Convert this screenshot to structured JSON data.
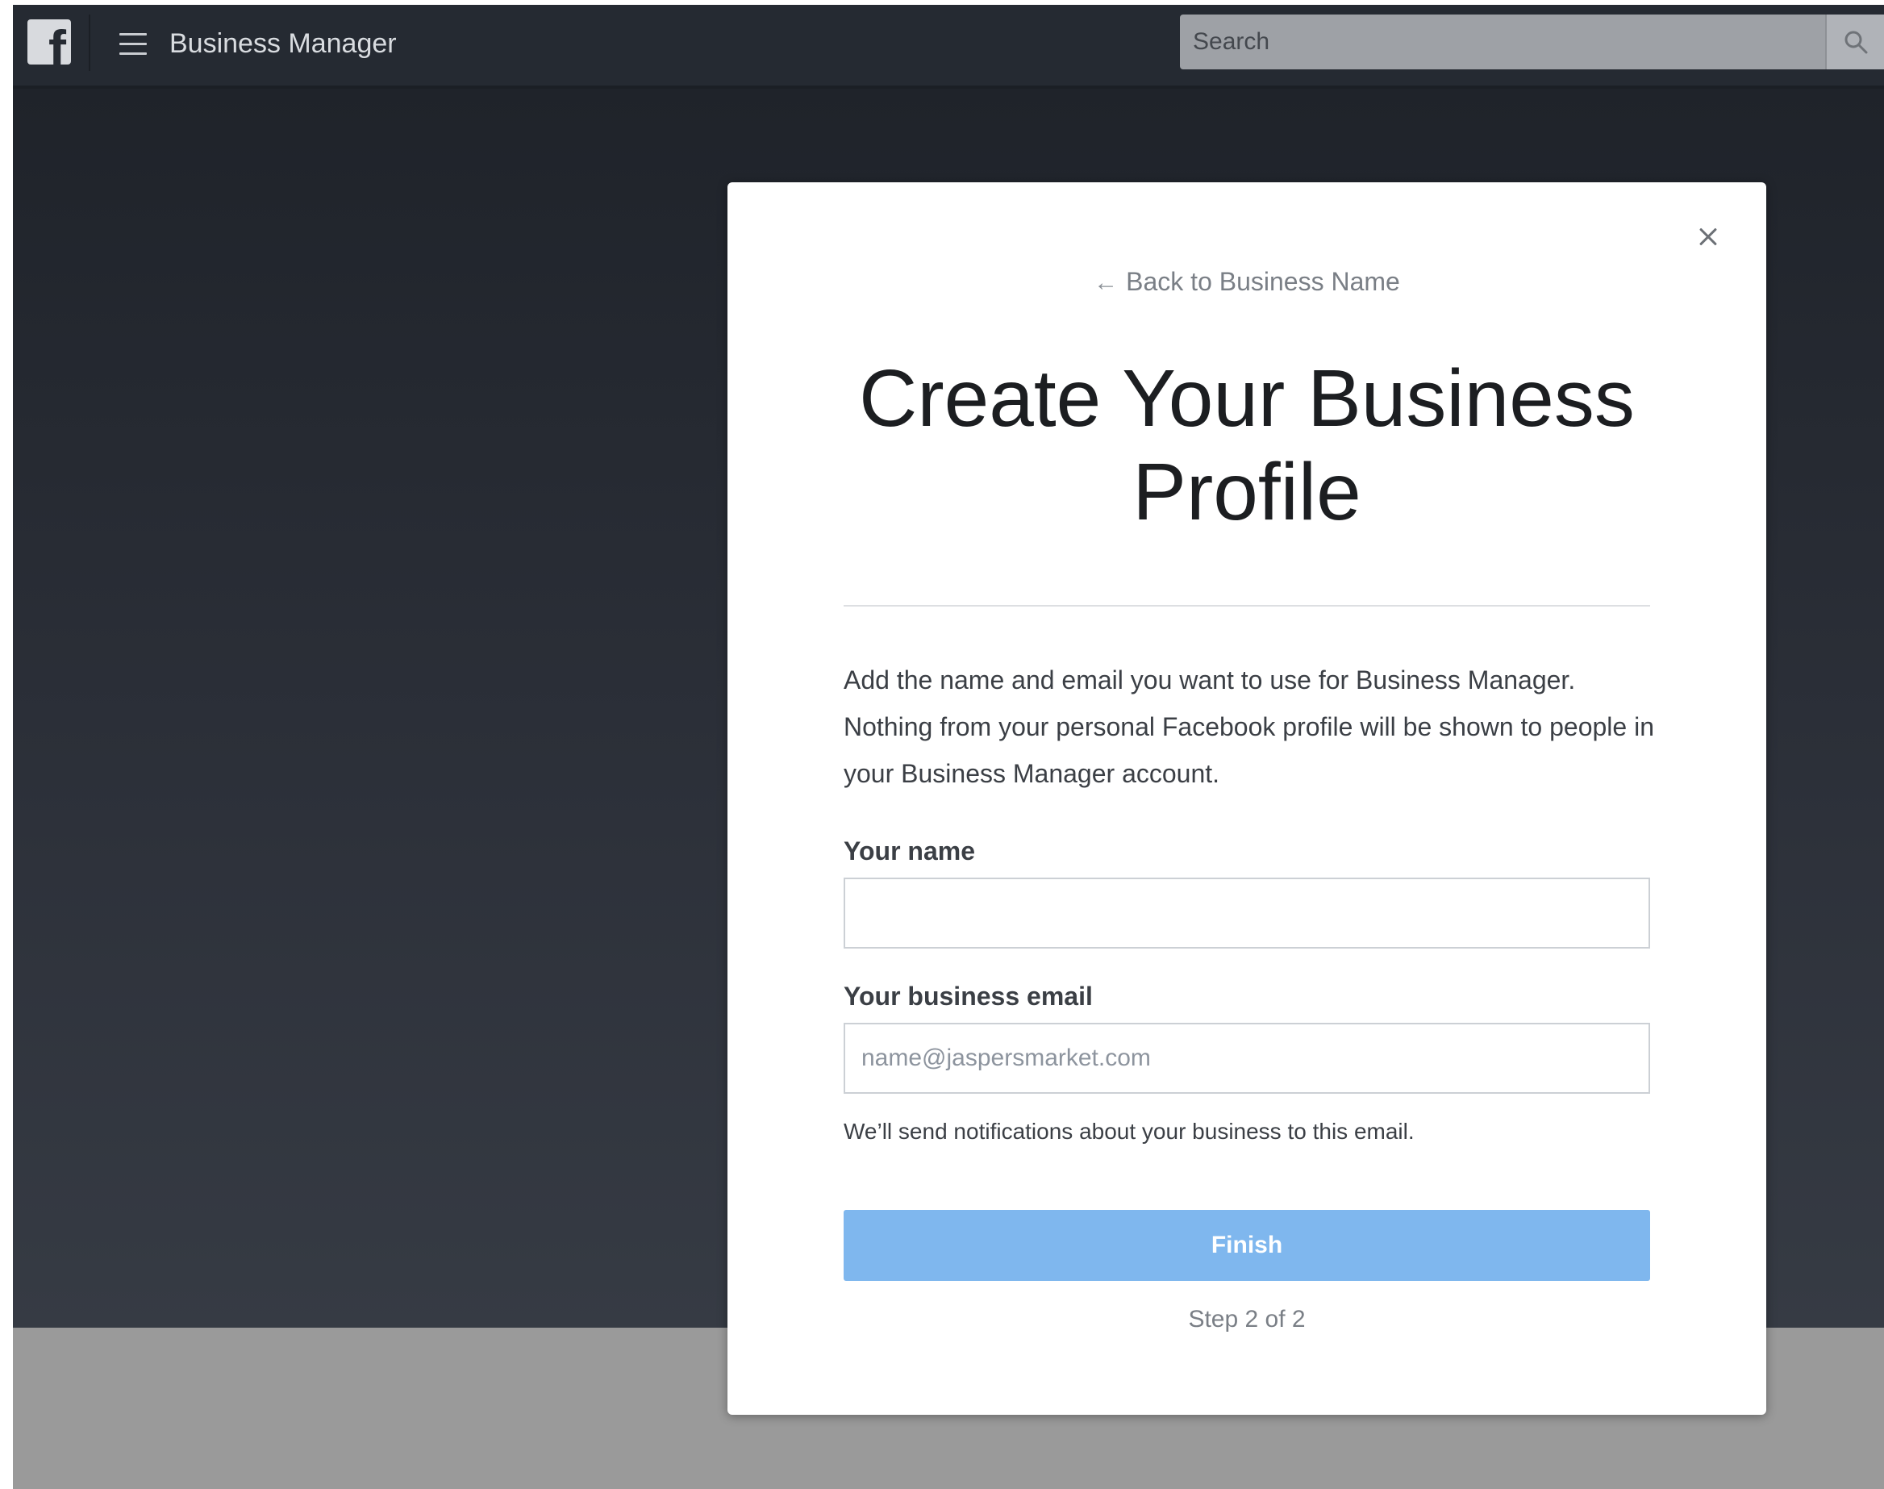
{
  "topbar": {
    "logo_icon": "facebook-f-icon",
    "menu_icon": "hamburger-menu-icon",
    "title": "Business Manager",
    "search_placeholder": "Search",
    "search_icon": "search-icon"
  },
  "modal": {
    "close_icon": "close-icon",
    "back_arrow_icon": "left-arrow-icon",
    "back_label": "Back to Business Name",
    "title": "Create Your Business Profile",
    "intro": "Add the name and email you want to use for Business Manager. Nothing from your personal Facebook profile will be shown to people in your Business Manager account.",
    "name_label": "Your name",
    "name_value": "",
    "email_label": "Your business email",
    "email_placeholder": "name@jaspersmarket.com",
    "email_hint": "We’ll send notifications about your business to this email.",
    "finish_label": "Finish",
    "step_text": "Step 2 of 2"
  },
  "colors": {
    "topbar_bg": "#252a32",
    "finish_button_bg": "#7fb7ee",
    "title_text": "#1c1e21"
  }
}
